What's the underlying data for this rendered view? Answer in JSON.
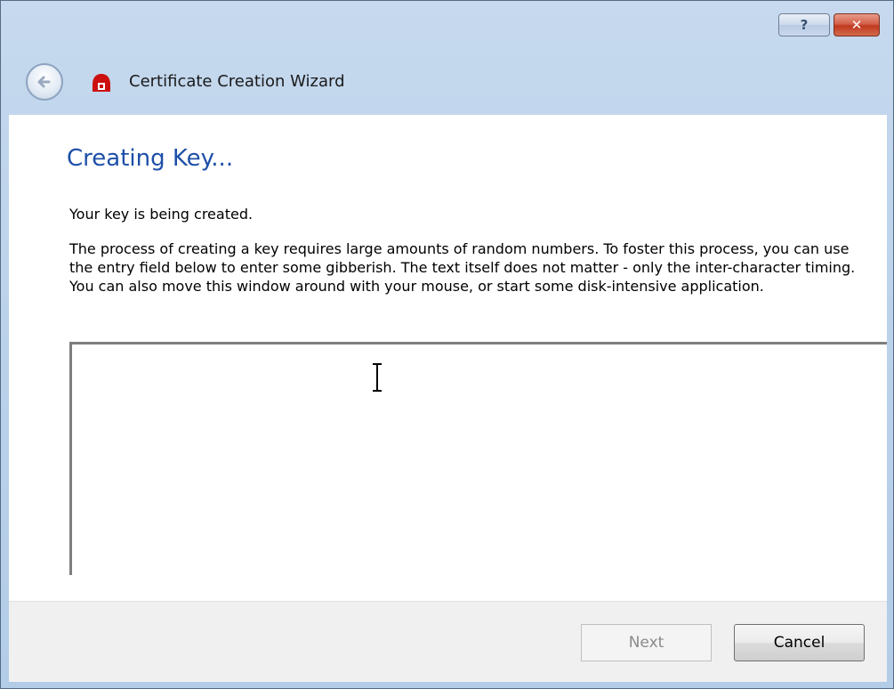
{
  "window": {
    "title": "Certificate Creation Wizard",
    "help_label": "?",
    "close_label": "✕"
  },
  "page": {
    "heading": "Creating Key...",
    "intro": "Your key is being created.",
    "description": "The process of creating a key requires large amounts of random numbers. To foster this process, you can use the entry field below to enter some gibberish. The text itself does not matter - only the inter-character timing. You can also move this window around with your mouse, or start some disk-intensive application."
  },
  "entry_field": {
    "value": ""
  },
  "footer": {
    "next_label": "Next",
    "cancel_label": "Cancel"
  },
  "icons": {
    "back": "back-arrow-icon",
    "app": "certificate-icon",
    "help": "help-icon",
    "close": "close-icon",
    "cursor": "text-cursor-icon"
  },
  "colors": {
    "heading": "#1e4fa8",
    "close_button": "#c1391e",
    "chrome": "#bcd3eb"
  }
}
